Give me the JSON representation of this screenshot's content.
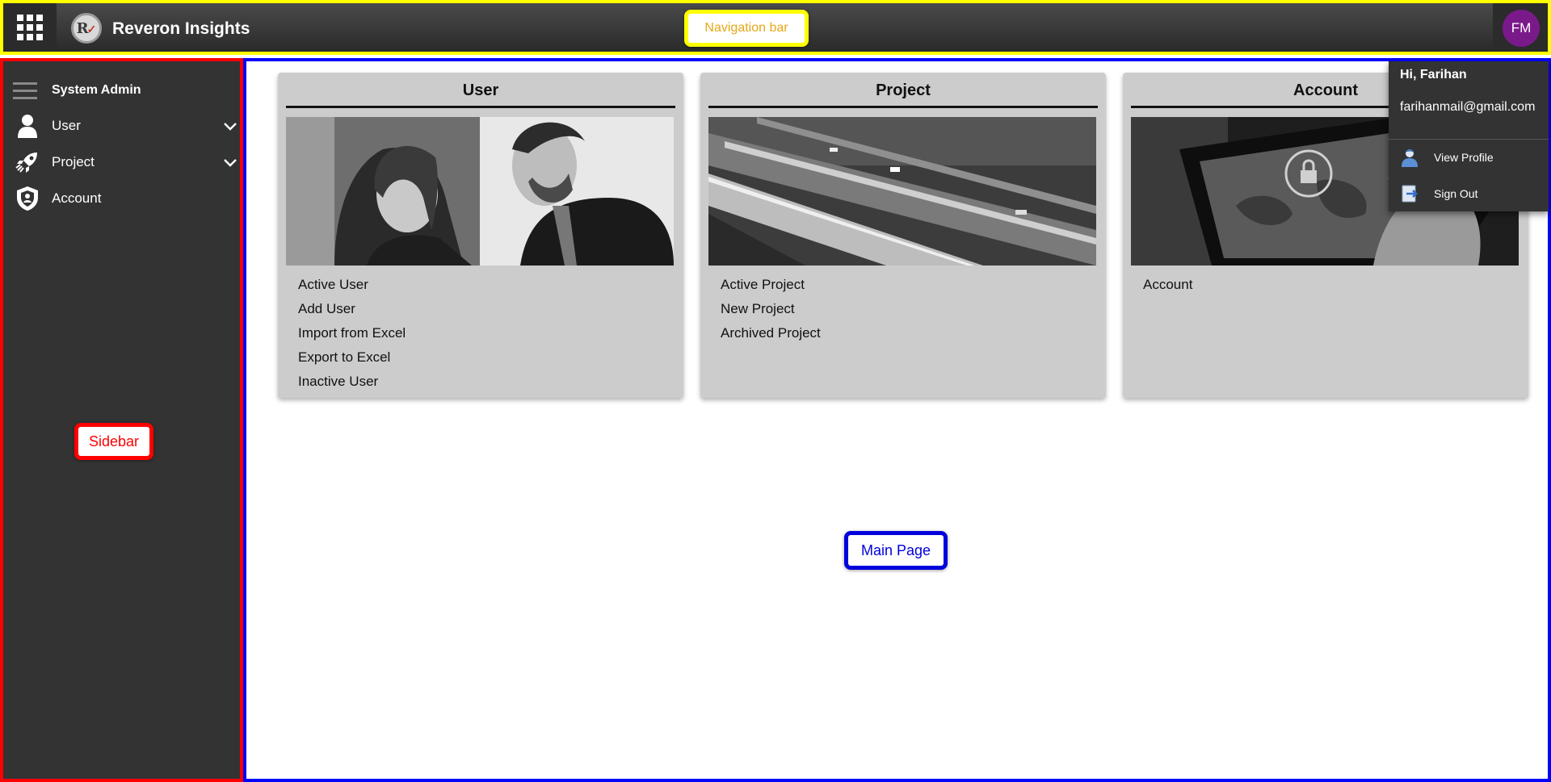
{
  "navbar": {
    "brand_logo_text": "R",
    "brand_title": "Reveron Insights",
    "annotation": "Navigation bar",
    "avatar_initials": "FM",
    "apps_icon": "apps-grid-icon"
  },
  "sidebar": {
    "title": "System Admin",
    "annotation": "Sidebar",
    "items": [
      {
        "label": "User",
        "icon": "user-icon",
        "expandable": true
      },
      {
        "label": "Project",
        "icon": "rocket-icon",
        "expandable": true
      },
      {
        "label": "Account",
        "icon": "shield-icon",
        "expandable": false
      }
    ]
  },
  "main": {
    "annotation": "Main Page",
    "cards": [
      {
        "title": "User",
        "image": "business-people-photo",
        "links": [
          "Active User",
          "Add User",
          "Import from Excel",
          "Export to Excel",
          "Inactive User"
        ]
      },
      {
        "title": "Project",
        "image": "highway-bridge-photo",
        "links": [
          "Active Project",
          "New Project",
          "Archived Project"
        ]
      },
      {
        "title": "Account",
        "image": "tablet-security-photo",
        "links": [
          "Account"
        ]
      }
    ]
  },
  "profile_menu": {
    "greeting": "Hi, Farihan",
    "email": "farihanmail@gmail.com",
    "view_profile": "View Profile",
    "sign_out": "Sign Out"
  },
  "colors": {
    "annotation_navbar": "#ffff00",
    "annotation_sidebar": "#ff0000",
    "annotation_main": "#0000ff",
    "avatar_bg": "#7a1a8a",
    "sidebar_bg": "#333333",
    "card_bg": "#cccccc"
  }
}
